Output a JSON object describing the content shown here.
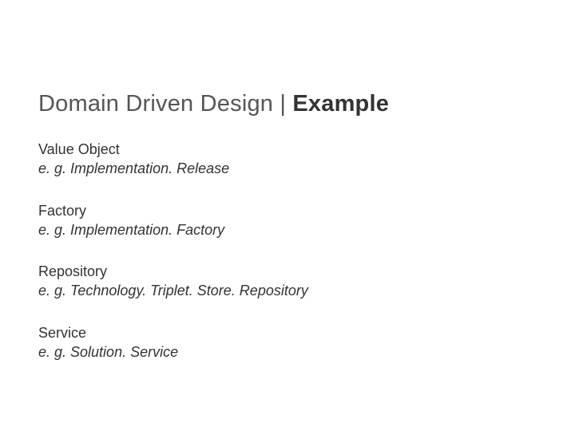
{
  "title": {
    "prefix": "Domain Driven Design | ",
    "highlight": "Example"
  },
  "blocks": [
    {
      "name": "Value Object",
      "eg_label": "e. g. ",
      "example_text": "Implementation. Release"
    },
    {
      "name": "Factory",
      "eg_label": "e. g. ",
      "example_text": "Implementation. Factory"
    },
    {
      "name": "Repository",
      "eg_label": "e. g. ",
      "example_text": "Technology. Triplet. Store. Repository"
    },
    {
      "name": "Service",
      "eg_label": "e. g. ",
      "example_text": "Solution. Service"
    }
  ]
}
